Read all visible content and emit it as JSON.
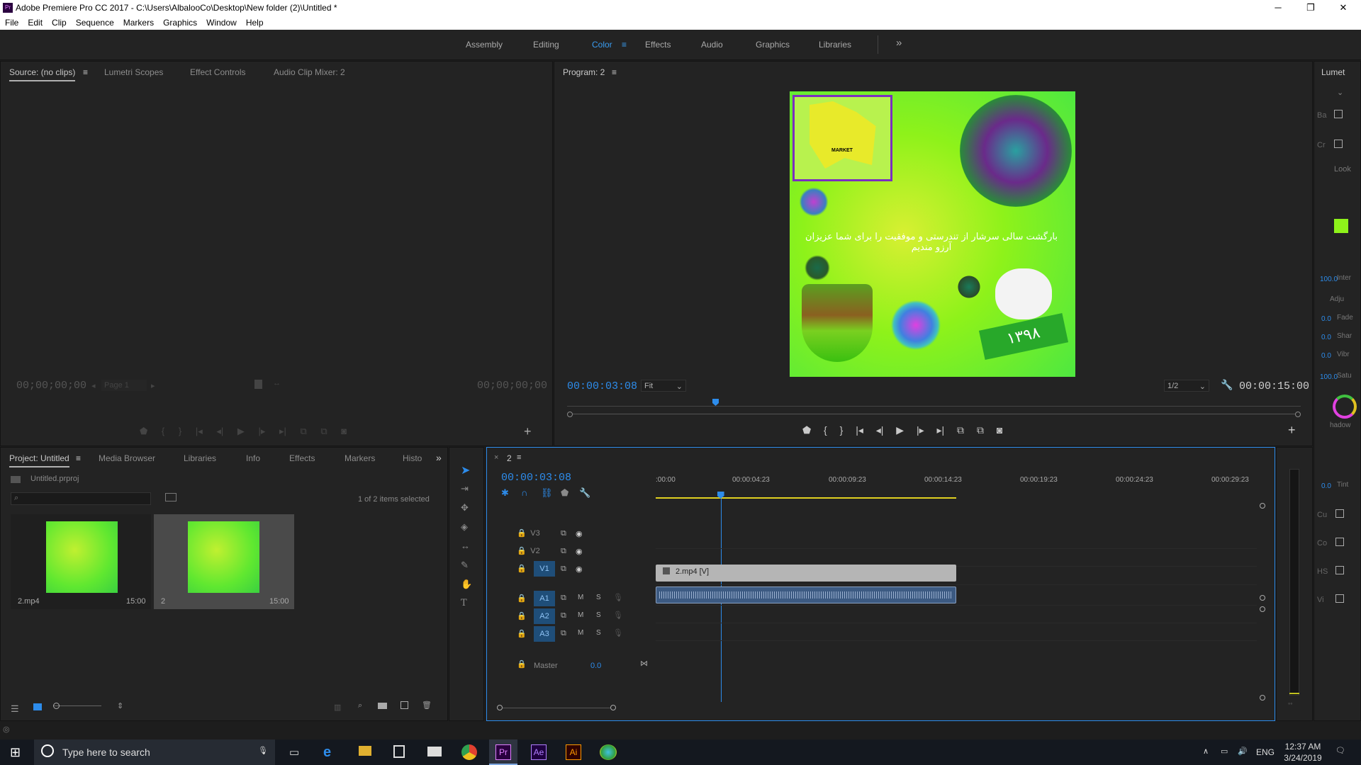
{
  "window": {
    "title": "Adobe Premiere Pro CC 2017 - C:\\Users\\AlbalooCo\\Desktop\\New folder (2)\\Untitled *",
    "app_icon": "Pr",
    "controls": [
      "─",
      "❐",
      "✕"
    ]
  },
  "menu": [
    "File",
    "Edit",
    "Clip",
    "Sequence",
    "Markers",
    "Graphics",
    "Window",
    "Help"
  ],
  "workspaces": [
    "Assembly",
    "Editing",
    "Color",
    "Effects",
    "Audio",
    "Graphics",
    "Libraries"
  ],
  "active_workspace": "Color",
  "more_label": "»",
  "source": {
    "tabs": [
      "Source: (no clips)",
      "Lumetri Scopes",
      "Effect Controls",
      "Audio Clip Mixer: 2"
    ],
    "tc_left": "00;00;00;00",
    "tc_right": "00;00;00;00",
    "page": "Page 1"
  },
  "program": {
    "tab": "Program: 2",
    "tc_current": "00:00:03:08",
    "fit": "Fit",
    "resolution": "1/2",
    "tc_duration": "00:00:15:00",
    "frame": {
      "persian_text": "بارگشت سالی سرشار از تندرستی و موفقیت را برای شما عزیزان آرزو مندیم",
      "badge_year": "۱۳۹۸",
      "logo_text": "MARKET"
    }
  },
  "project": {
    "tabs": [
      "Project: Untitled",
      "Media Browser",
      "Libraries",
      "Info",
      "Effects",
      "Markers",
      "Histo"
    ],
    "file": "Untitled.prproj",
    "selection": "1 of 2 items selected",
    "items": [
      {
        "name": "2.mp4",
        "duration": "15:00"
      },
      {
        "name": "2",
        "duration": "15:00"
      }
    ]
  },
  "timeline": {
    "tab": "2",
    "tc": "00:00:03:08",
    "ruler": [
      ":00:00",
      "00:00:04:23",
      "00:00:09:23",
      "00:00:14:23",
      "00:00:19:23",
      "00:00:24:23",
      "00:00:29:23"
    ],
    "video_tracks": [
      "V3",
      "V2",
      "V1"
    ],
    "audio_tracks": [
      "A1",
      "A2",
      "A3"
    ],
    "master": "Master",
    "master_val": "0.0",
    "clip_label": "2.mp4 [V]",
    "playhead_fraction": 0.108,
    "clip_end_fraction": 0.5
  },
  "lumetri": {
    "title": "Lumet",
    "rows": [
      "Ba",
      "Cr",
      "Look",
      "Inter",
      "Adju",
      "Fade",
      "Shar",
      "Vibr",
      "Satu",
      "hadow",
      "Tint",
      "Cu",
      "Co",
      "HS",
      "Vi"
    ],
    "values": [
      "100.0",
      "0.0",
      "0.0",
      "0.0",
      "100.0",
      "0.0"
    ]
  },
  "taskbar": {
    "search": "Type here to search",
    "apps": [
      "Pr",
      "Ae",
      "Ai"
    ],
    "lang": "ENG",
    "time": "12:37 AM",
    "date": "3/24/2019"
  },
  "colors": {
    "accent": "#2d8ceb",
    "workspace_active": "#3a9cf0",
    "clip_video": "#b5b5b5",
    "clip_audio": "#3c5a82",
    "purple_frame": "#7b2fbf",
    "green_bg": "#7cfc00"
  }
}
